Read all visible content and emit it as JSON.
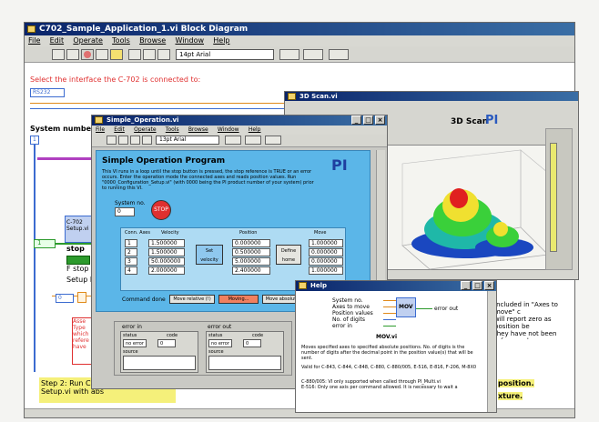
{
  "main_window": {
    "title": "C702_Sample_Application_1.vi Block Diagram",
    "menu": [
      "File",
      "Edit",
      "Operate",
      "Tools",
      "Browse",
      "Window",
      "Help"
    ],
    "font_select": "14pt Arial",
    "instruction": "Select the interface the C-702 is connected to:",
    "interface_value": "RS232",
    "system_number_label": "System number is",
    "loop_index": "1",
    "small_num": "0",
    "stop_label": "stop",
    "stop_text": "F stop",
    "setup_text": "Setup bl",
    "c702_label": "C-702 Setup.vi",
    "zero_value": "0",
    "step_note": "Step 2: Run C702\nSetup.vi with abs",
    "red_note": "Asse\nType\nwhich\nrefere\nhave",
    "right_note": "Included in \"Axes to move\" c\nwill report zero as position be\nthey have not been referenced",
    "position_note": "position.",
    "fixture_note": "xture."
  },
  "operation_window": {
    "title": "Simple_Operation.vi",
    "menu": [
      "File",
      "Edit",
      "Operate",
      "Tools",
      "Browse",
      "Window",
      "Help"
    ],
    "font_select": "13pt Arial",
    "heading": "Simple Operation Program",
    "description": "This VI runs in a loop until the stop button is pressed, the stop reference is TRUE or an error occurs. Enter the operation mode the connected axes and reads position values. Run \"0000_Configuration_Setup.vi\" (with 0000 being the PI product number of your system) prior to running this VI.",
    "logo": "PI",
    "system_no_label": "System no.",
    "system_no_value": "0",
    "stop_button": "STOP",
    "table_headers": [
      "Conn. Axes",
      "Velocity",
      "Position",
      "Move"
    ],
    "axes": [
      "1",
      "2",
      "3",
      "4"
    ],
    "velocities": [
      "1.500000",
      "1.500000",
      "50.000000",
      "2.000000"
    ],
    "positions": [
      "0.000000",
      "0.500000",
      "5.000000",
      "2.400000"
    ],
    "moves": [
      "1.000000",
      "0.000000",
      "0.000000",
      "1.000000"
    ],
    "set_velocity_button": "Set velocity",
    "define_home_button": "Define home",
    "command_label": "Command done",
    "cmd_buttons": [
      "Move relative (!)",
      "Moving...",
      "Move absolute"
    ],
    "error_in_label": "error in",
    "error_out_label": "error out",
    "status_label": "status",
    "code_label": "code",
    "source_label": "source",
    "status_value": "no error",
    "code_value": "0"
  },
  "scan_window": {
    "title": "3D Scan.vi",
    "heading": "3D Scan",
    "logo": "PI"
  },
  "help_window": {
    "title": "Help",
    "inputs": [
      "System no.",
      "Axes to move",
      "Position values",
      "No. of digits",
      "error in"
    ],
    "node_label": "MOV",
    "output": "error out",
    "vi_name": "MOV.vi",
    "text1": "Moves specified axes to specified absolute positions. No. of digits is the number of digits after the decimal point in the position value(s) that will be sent.",
    "text2": "Valid for C-843, C-844, C-848, C-880, C-880/005, E-516, E-816, F-206, M-8X0",
    "text3": "C-880/005: VI only supported when called through PI_Multi.vi\nE-516: Only one axis per command allowed. It is necessary to wait a"
  },
  "colors": {
    "title_bar": "#0a246a",
    "panel_blue": "#5bb6e8",
    "wire_orange": "#e08a1a",
    "wire_blue": "#3b6bd0",
    "wire_green": "#2c9a2c"
  }
}
